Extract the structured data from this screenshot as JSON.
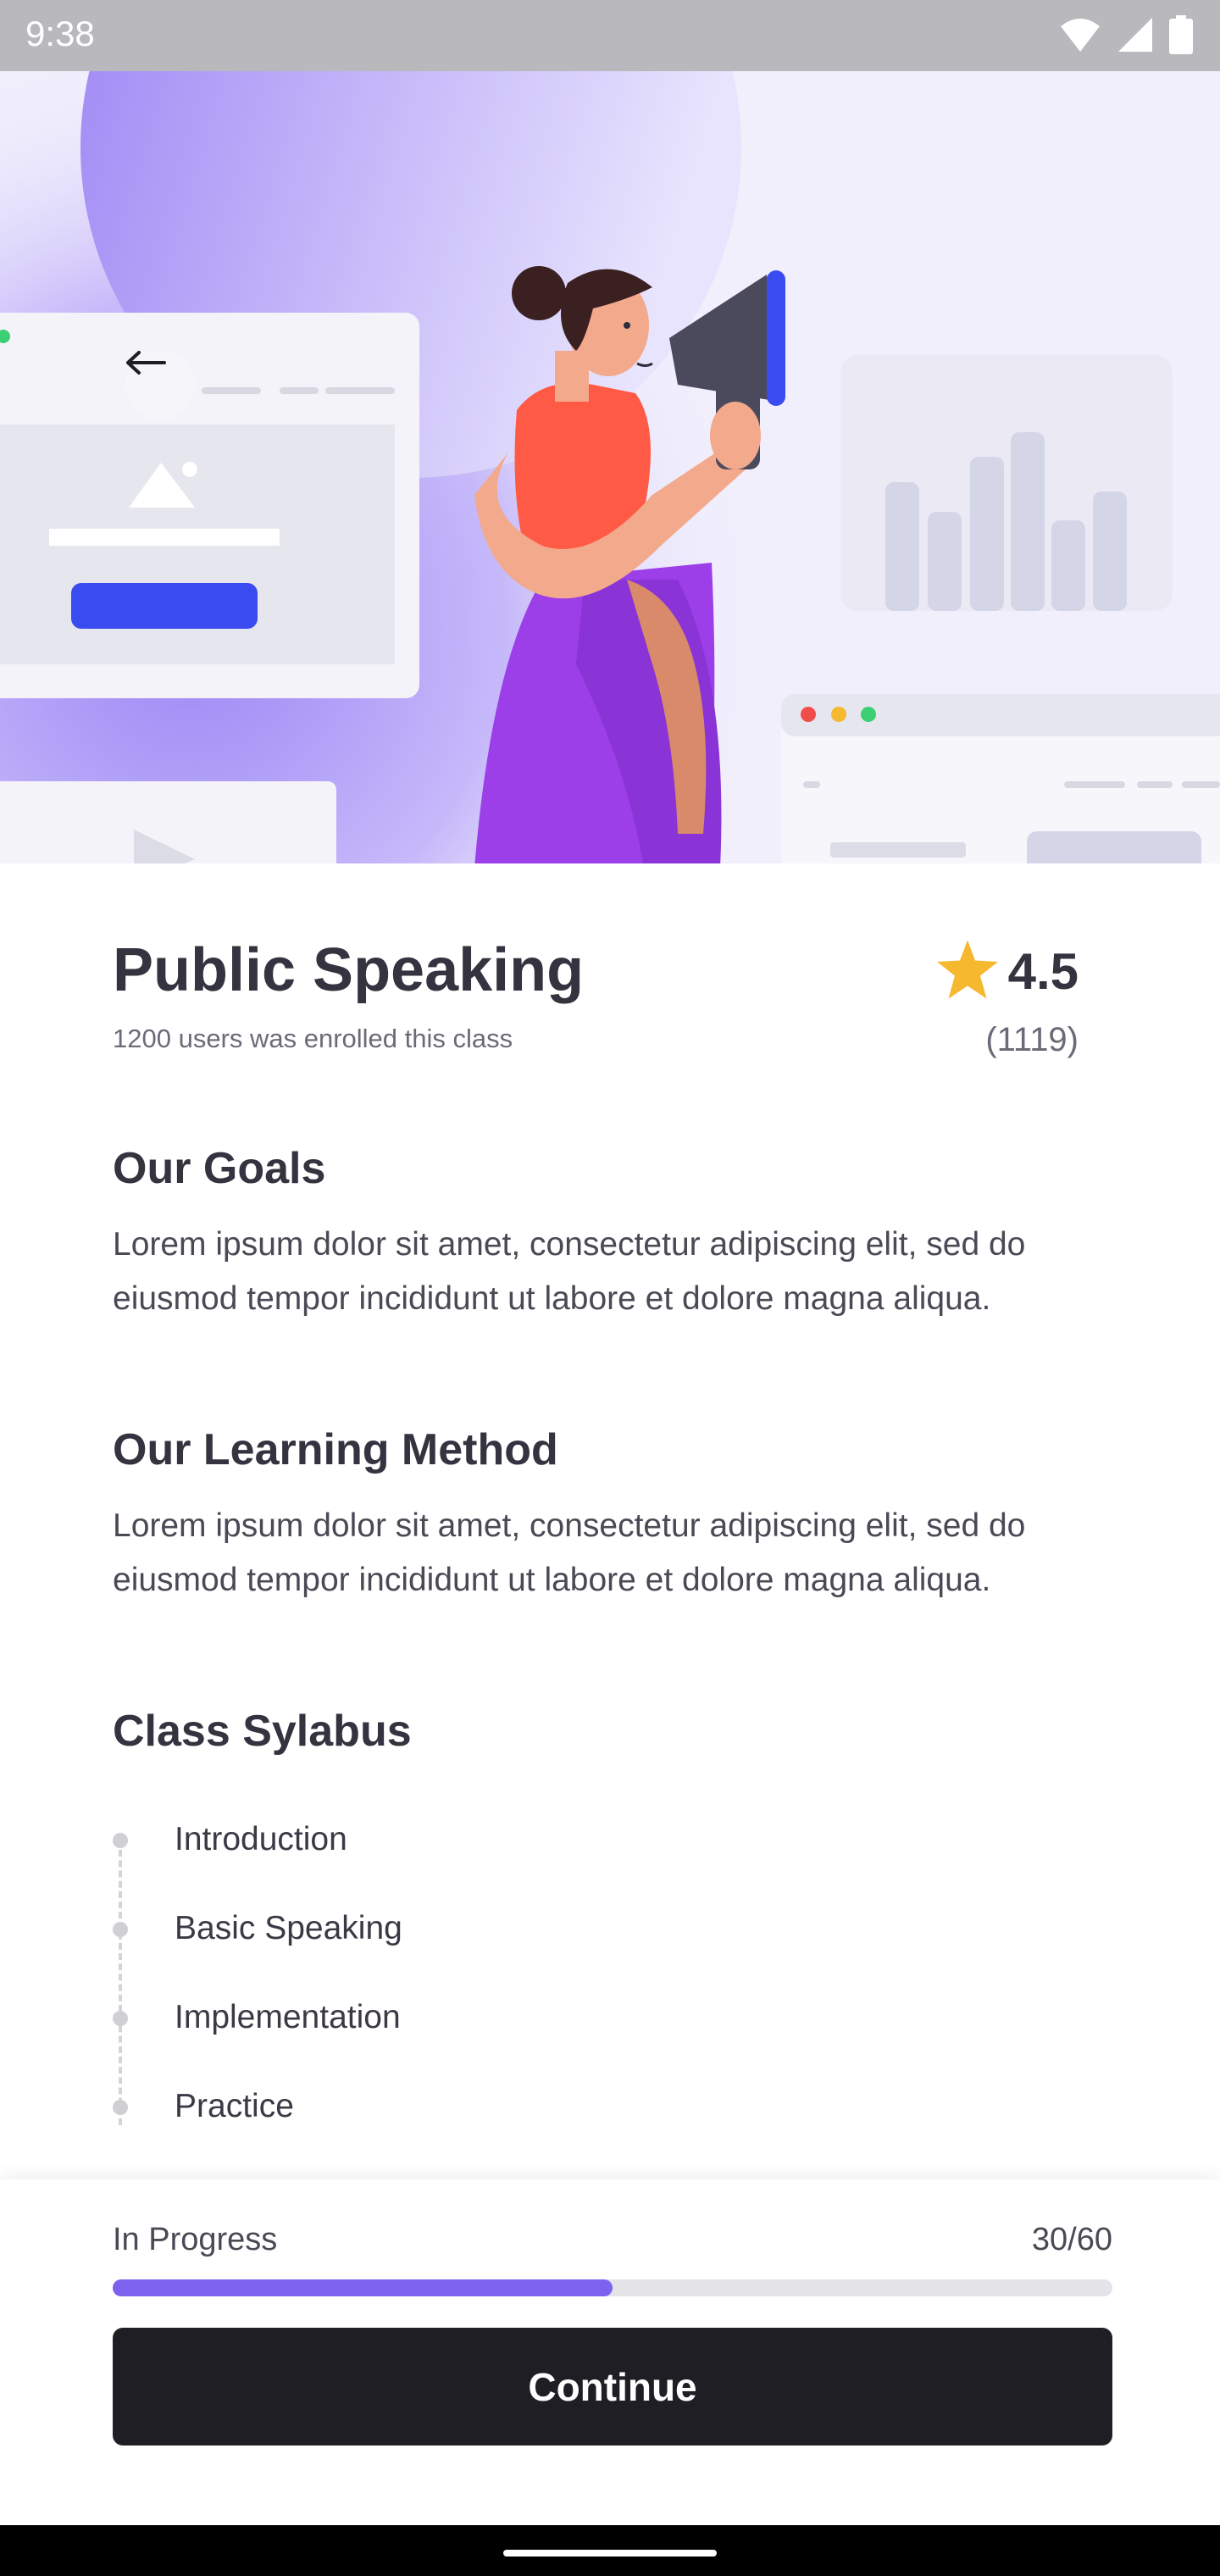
{
  "status_bar": {
    "time": "9:38"
  },
  "course": {
    "title": "Public Speaking",
    "enrolled_text": "1200 users was enrolled this class",
    "rating": "4.5",
    "rating_count": "(1119)",
    "star_color": "#f5b82e"
  },
  "sections": [
    {
      "title": "Our Goals",
      "text": "Lorem ipsum dolor sit amet, consectetur adipiscing elit, sed do eiusmod tempor incididunt ut labore et dolore magna aliqua."
    },
    {
      "title": "Our Learning Method",
      "text": "Lorem ipsum dolor sit amet, consectetur adipiscing elit, sed do eiusmod tempor incididunt ut labore et dolore magna aliqua."
    }
  ],
  "syllabus": {
    "title": "Class Sylabus",
    "items": [
      "Introduction",
      "Basic Speaking",
      "Implementation",
      "Practice"
    ]
  },
  "progress": {
    "label": "In Progress",
    "count_text": "30/60",
    "fraction": 0.5,
    "color": "#7c62ee"
  },
  "continue_label": "Continue",
  "icons": {
    "back": "arrow-left-icon",
    "star": "star-icon",
    "wifi": "wifi-icon",
    "signal": "signal-icon",
    "battery": "battery-icon"
  }
}
